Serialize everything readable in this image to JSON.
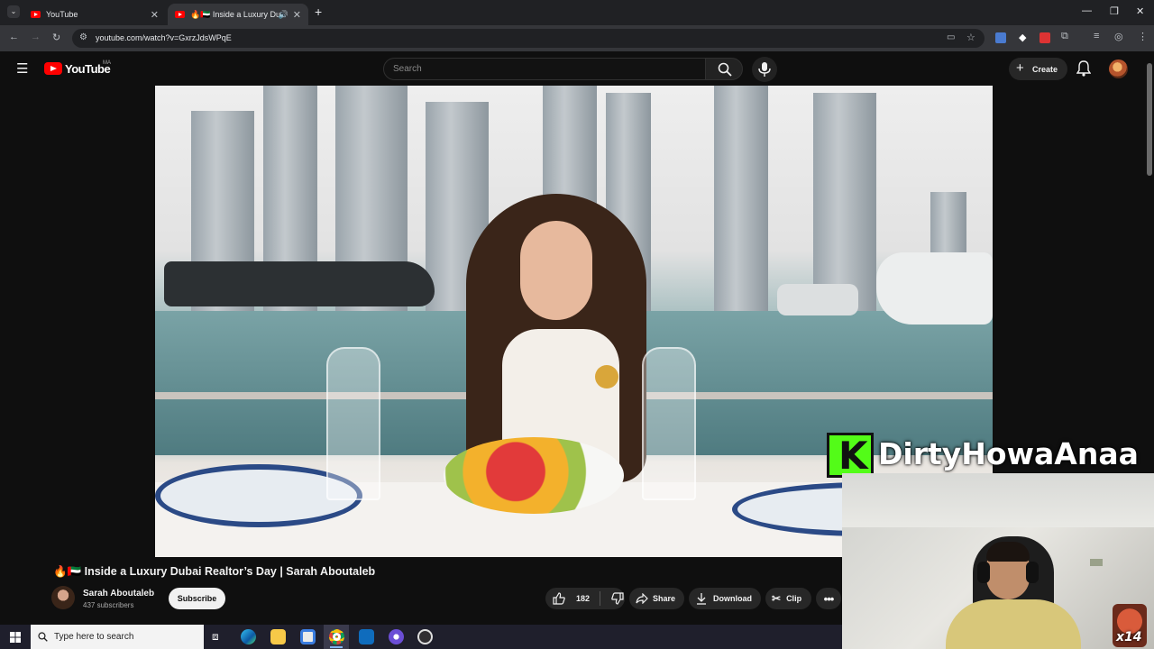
{
  "browser": {
    "tabs": [
      {
        "title": "YouTube",
        "active": false
      },
      {
        "title": "🔥🇦🇪 Inside a Luxury Dubai",
        "active": true
      }
    ],
    "url": "youtube.com/watch?v=GxrzJdsWPqE"
  },
  "youtube": {
    "logo_text": "YouTube",
    "region": "MA",
    "search_placeholder": "Search",
    "create_label": "Create"
  },
  "video": {
    "title": "🔥🇦🇪 Inside a Luxury Dubai Realtor’s Day | Sarah Aboutaleb",
    "channel_name": "Sarah Aboutaleb",
    "subscribers": "437 subscribers",
    "subscribe_label": "Subscribe",
    "like_count": "182",
    "share_label": "Share",
    "download_label": "Download",
    "clip_label": "Clip"
  },
  "overlay": {
    "streamer_name": "DirtyHowaAnaa",
    "badge_text": "x14"
  },
  "taskbar": {
    "search_placeholder": "Type here to search"
  },
  "colors": {
    "brand_red": "#ff0000",
    "kick_green": "#53fc18",
    "background": "#0f0f0f"
  }
}
